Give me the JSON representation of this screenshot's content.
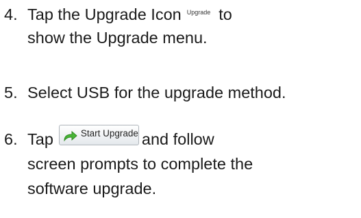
{
  "steps": [
    {
      "number": "4.",
      "text_before": "Tap the Upgrade Icon",
      "icon_label": "Upgrade",
      "text_after": "to",
      "line2": "show the Upgrade menu."
    },
    {
      "number": "5.",
      "text": "Select USB for the upgrade method."
    },
    {
      "number": "6.",
      "text_before": "Tap",
      "button_label": "Start Upgrade",
      "text_after": "and follow",
      "line2": "screen prompts to complete the",
      "line3": "software upgrade."
    }
  ],
  "colors": {
    "arrow_green": "#49b636",
    "text": "#1a1a1a"
  },
  "icons": [
    "upgrade-arrow-icon"
  ]
}
